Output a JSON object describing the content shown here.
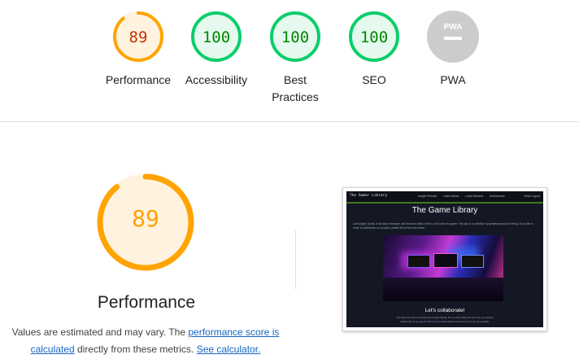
{
  "gauges": [
    {
      "label": "Performance",
      "score": "89",
      "value": 89
    },
    {
      "label": "Accessibility",
      "score": "100",
      "value": 100
    },
    {
      "label": "Best Practices",
      "score": "100",
      "value": 100
    },
    {
      "label": "SEO",
      "score": "100",
      "value": 100
    },
    {
      "label": "PWA",
      "score": "",
      "value": null,
      "badge": "PWA"
    }
  ],
  "colors": {
    "average_arc": "#ffa400",
    "average_fill": "#fff3e0",
    "average_text": "#c33300",
    "pass_arc": "#0cce6b",
    "pass_fill": "#e5f9ee",
    "pass_text": "#008800",
    "na": "#cccccc"
  },
  "icons": {
    "pwa": "pwa-badge-icon"
  },
  "main": {
    "score": "89",
    "value": 89,
    "title": "Performance",
    "desc_prefix": "Values are estimated and may vary. The ",
    "link_score": "performance score is calculated",
    "desc_middle": " directly from these metrics. ",
    "link_calc": "See calculator."
  },
  "screenshot": {
    "brand": "The Gamer Library",
    "nav": [
      "Insight Rebuild",
      "Latest News",
      "Least Wanted",
      "Dashboards"
    ],
    "nav_right": "Hello  Logout",
    "heading": "The Game Library",
    "intro": "Lore Angelo Sarda, a full stack developer and front-end editor, here is a bit more of a game. This app is a collection by greatest passion of being. If you like to reach to collaborate on a project, please fill out the form below.",
    "subheading": "Let's collaborate!",
    "outro": "This app has been developed by Angelo Sarda. Do you like what you see? Do you want to collaborate on a project? Fill the form below and let us know how soon as possible."
  }
}
